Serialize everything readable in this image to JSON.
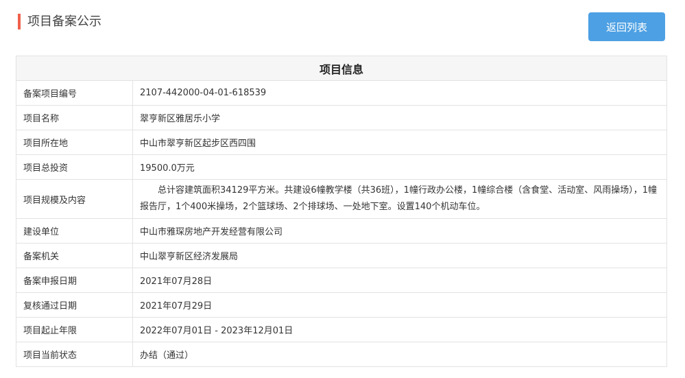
{
  "header": {
    "title": "项目备案公示",
    "back_button": "返回列表"
  },
  "table": {
    "heading": "项目信息",
    "rows": [
      {
        "label": "备案项目编号",
        "value": "2107-442000-04-01-618539"
      },
      {
        "label": "项目名称",
        "value": "翠亨新区雅居乐小学"
      },
      {
        "label": "项目所在地",
        "value": "中山市翠亨新区起步区西四围"
      },
      {
        "label": "项目总投资",
        "value": "19500.0万元"
      },
      {
        "label": "项目规模及内容",
        "value": "总计容建筑面积34129平方米。共建设6幢教学楼（共36班），1幢行政办公楼，1幢综合楼（含食堂、活动室、风雨操场），1幢报告厅，1个400米操场，2个篮球场、2个排球场、一处地下室。设置140个机动车位。"
      },
      {
        "label": "建设单位",
        "value": "中山市雅琛房地产开发经营有限公司"
      },
      {
        "label": "备案机关",
        "value": "中山翠亨新区经济发展局"
      },
      {
        "label": "备案申报日期",
        "value": "2021年07月28日"
      },
      {
        "label": "复核通过日期",
        "value": "2021年07月29日"
      },
      {
        "label": "项目起止年限",
        "value": "2022年07月01日 - 2023年12月01日"
      },
      {
        "label": "项目当前状态",
        "value": "办结（通过）"
      }
    ]
  }
}
